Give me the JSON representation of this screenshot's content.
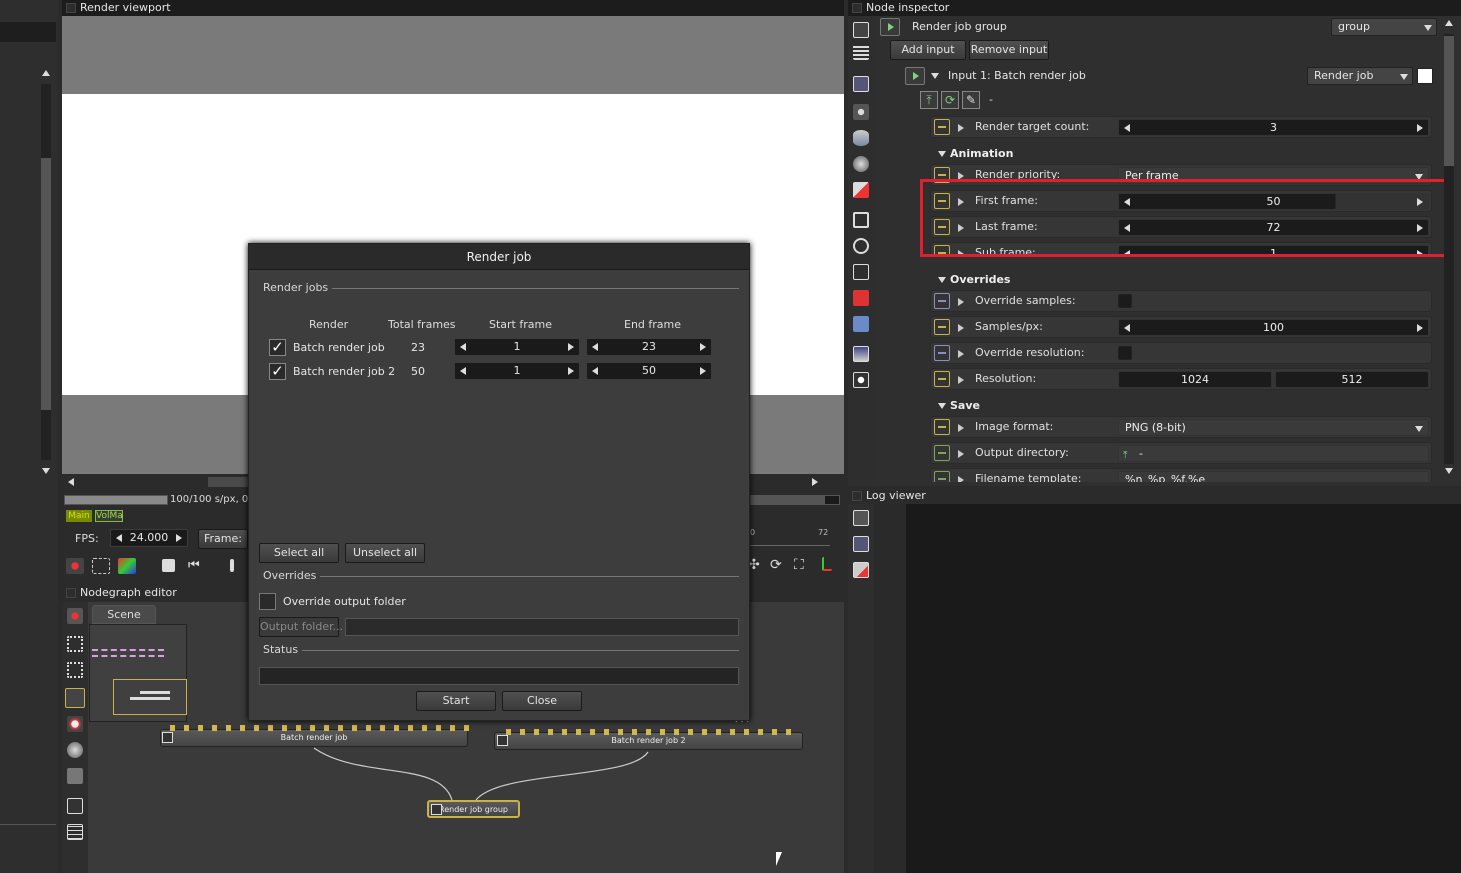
{
  "render_viewport": {
    "title": "Render viewport",
    "stats": "100/100 s/px, 00:00",
    "tag_main": "Main",
    "tag_volma": "VolMa",
    "fps_label": "FPS:",
    "fps_value": "24.000",
    "frame_label": "Frame:",
    "timeline_end": "72",
    "timeline_start": "0"
  },
  "nodegraph": {
    "title": "Nodegraph editor",
    "tab": "Scene",
    "nodes": [
      "Batch render job",
      "Batch render job 2",
      "Render job group"
    ]
  },
  "dialog": {
    "title": "Render job",
    "section_jobs": "Render jobs",
    "col_render": "Render",
    "col_total": "Total frames",
    "col_start": "Start frame",
    "col_end": "End frame",
    "jobs": [
      {
        "name": "Batch render job",
        "checked": true,
        "total": "23",
        "start": "1",
        "end": "23"
      },
      {
        "name": "Batch render job 2",
        "checked": true,
        "total": "50",
        "start": "1",
        "end": "50"
      }
    ],
    "select_all": "Select all",
    "unselect_all": "Unselect all",
    "section_overrides": "Overrides",
    "override_output": "Override output folder",
    "output_folder_btn": "Output folder...",
    "section_status": "Status",
    "start": "Start",
    "close": "Close"
  },
  "inspector": {
    "title": "Node inspector",
    "node_name": "Render job group",
    "node_type": "group",
    "add_input": "Add input",
    "remove_input": "Remove input",
    "input_label": "Input 1: Batch render job",
    "input_type": "Render job",
    "dash": "-",
    "render_target_label": "Render target count:",
    "render_target_value": "3",
    "sect_animation": "Animation",
    "render_priority_label": "Render priority:",
    "render_priority_value": "Per frame",
    "first_frame_label": "First frame:",
    "first_frame_value": "50",
    "last_frame_label": "Last frame:",
    "last_frame_value": "72",
    "sub_frame_label": "Sub frame:",
    "sub_frame_value": "1",
    "sect_overrides": "Overrides",
    "override_samples_label": "Override samples:",
    "samples_label": "Samples/px:",
    "samples_value": "100",
    "override_res_label": "Override resolution:",
    "resolution_label": "Resolution:",
    "res_w": "1024",
    "res_h": "512",
    "sect_save": "Save",
    "image_format_label": "Image format:",
    "image_format_value": "PNG (8-bit)",
    "output_dir_label": "Output directory:",
    "output_dir_value": "-",
    "filename_label": "Filename template:",
    "filename_value": "%n_%p_%f.%e"
  },
  "log_viewer": {
    "title": "Log viewer"
  },
  "colors": {
    "highlight": "#e0202c",
    "accent_yellow": "#c8b24a"
  }
}
